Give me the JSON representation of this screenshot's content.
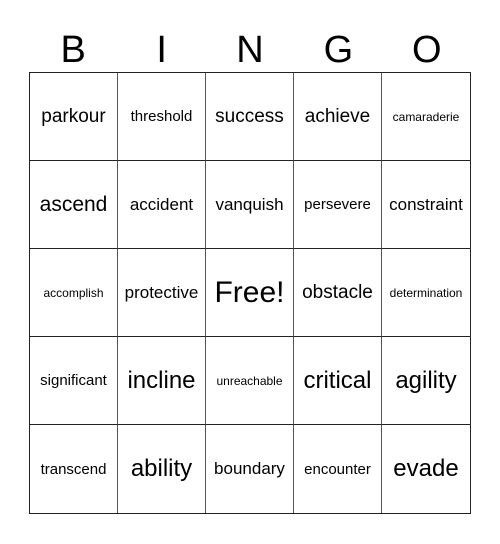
{
  "header": [
    "B",
    "I",
    "N",
    "G",
    "O"
  ],
  "cells": [
    {
      "text": "parkour",
      "size": "s4"
    },
    {
      "text": "threshold",
      "size": "s2"
    },
    {
      "text": "success",
      "size": "s4"
    },
    {
      "text": "achieve",
      "size": "s4"
    },
    {
      "text": "camaraderie",
      "size": "s1"
    },
    {
      "text": "ascend",
      "size": "s5"
    },
    {
      "text": "accident",
      "size": "s3"
    },
    {
      "text": "vanquish",
      "size": "s3"
    },
    {
      "text": "persevere",
      "size": "s2"
    },
    {
      "text": "constraint",
      "size": "s3"
    },
    {
      "text": "accomplish",
      "size": "s1"
    },
    {
      "text": "protective",
      "size": "s3"
    },
    {
      "text": "Free!",
      "size": "s7"
    },
    {
      "text": "obstacle",
      "size": "s4"
    },
    {
      "text": "determination",
      "size": "s1"
    },
    {
      "text": "significant",
      "size": "s2"
    },
    {
      "text": "incline",
      "size": "s6"
    },
    {
      "text": "unreachable",
      "size": "s1"
    },
    {
      "text": "critical",
      "size": "s6"
    },
    {
      "text": "agility",
      "size": "s6"
    },
    {
      "text": "transcend",
      "size": "s2"
    },
    {
      "text": "ability",
      "size": "s6"
    },
    {
      "text": "boundary",
      "size": "s3"
    },
    {
      "text": "encounter",
      "size": "s2"
    },
    {
      "text": "evade",
      "size": "s6"
    }
  ]
}
